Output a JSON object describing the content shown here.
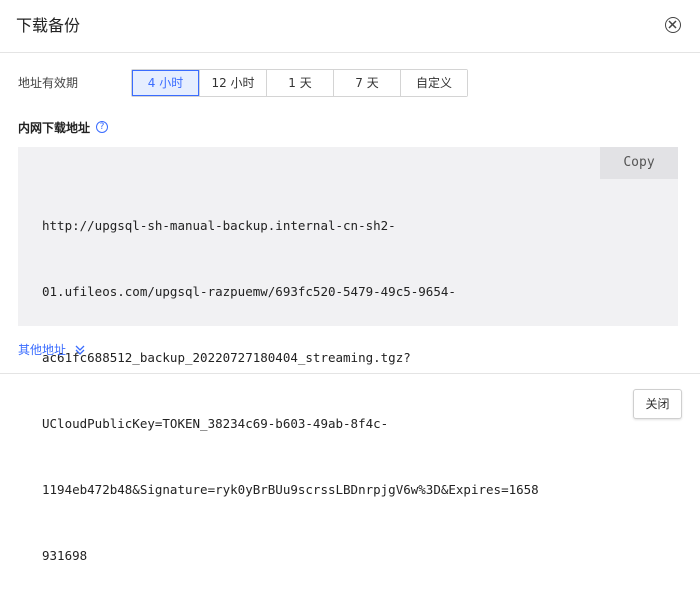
{
  "dialog": {
    "title": "下载备份"
  },
  "validity": {
    "label": "地址有效期",
    "options": [
      {
        "label": "4 小时",
        "active": true
      },
      {
        "label": "12 小时",
        "active": false
      },
      {
        "label": "1 天",
        "active": false
      },
      {
        "label": "7 天",
        "active": false
      },
      {
        "label": "自定义",
        "active": false
      }
    ]
  },
  "intranet": {
    "label": "内网下载地址",
    "help_icon": "question-circle-icon",
    "copy_label": "Copy",
    "url_lines": [
      "http://upgsql-sh-manual-backup.internal-cn-sh2-",
      "01.ufileos.com/upgsql-razpuemw/693fc520-5479-49c5-9654-",
      "ac61fc688512_backup_20220727180404_streaming.tgz?",
      "UCloudPublicKey=TOKEN_38234c69-b603-49ab-8f4c-",
      "1194eb472b48&Signature=ryk0yBrBUu9scrssLBDnrpjgV6w%3D&Expires=1658",
      "931698"
    ]
  },
  "other": {
    "label": "其他地址",
    "icon": "double-chevron-down-icon"
  },
  "footer": {
    "close_label": "关闭"
  },
  "colors": {
    "accent": "#3a6cff",
    "active_bg": "#e6eeff",
    "code_bg": "#f1f1f3"
  }
}
